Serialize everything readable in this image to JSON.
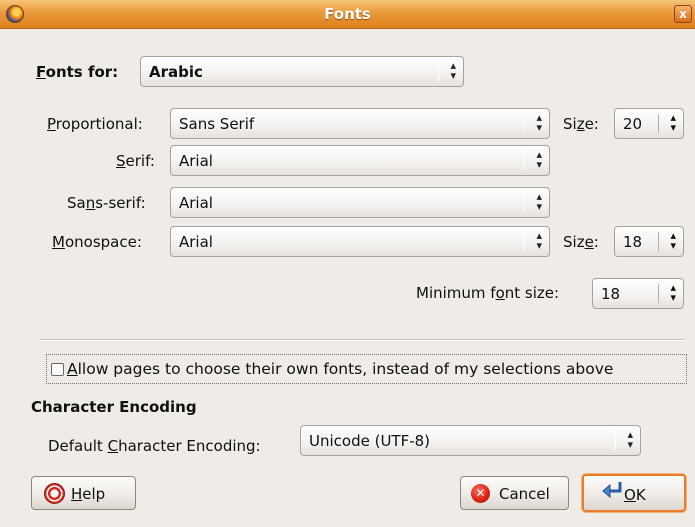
{
  "window": {
    "title": "Fonts",
    "close_glyph": "x"
  },
  "fonts_for": {
    "label": "Fonts for:",
    "value": "Arabic"
  },
  "rows": [
    {
      "label": "Proportional:",
      "value": "Sans Serif",
      "size_label": "Size:",
      "size_value": "20"
    },
    {
      "label": "Serif:",
      "value": "Arial"
    },
    {
      "label": "Sans-serif:",
      "value": "Arial"
    },
    {
      "label": "Monospace:",
      "value": "Arial",
      "size_label": "Size:",
      "size_value": "18"
    }
  ],
  "minimum_font_size": {
    "label": "Minimum font size:",
    "value": "18"
  },
  "allow_pages": {
    "label": "Allow pages to choose their own fonts, instead of my selections above",
    "checked": false
  },
  "encoding": {
    "section_title": "Character Encoding",
    "label": "Default Character Encoding:",
    "value": "Unicode (UTF-8)"
  },
  "buttons": {
    "help": "Help",
    "cancel": "Cancel",
    "ok": "OK"
  },
  "colors": {
    "titlebar_accent": "#dd7f1d",
    "ok_focus_border": "#e77b2b",
    "window_bg": "#efebe7"
  },
  "icons": {
    "app": "firefox-icon",
    "close": "close-icon",
    "help": "lifebuoy-icon",
    "cancel": "cancel-x-icon",
    "ok": "ok-arrow-icon",
    "dropdown": "up-down-arrows-icon"
  }
}
